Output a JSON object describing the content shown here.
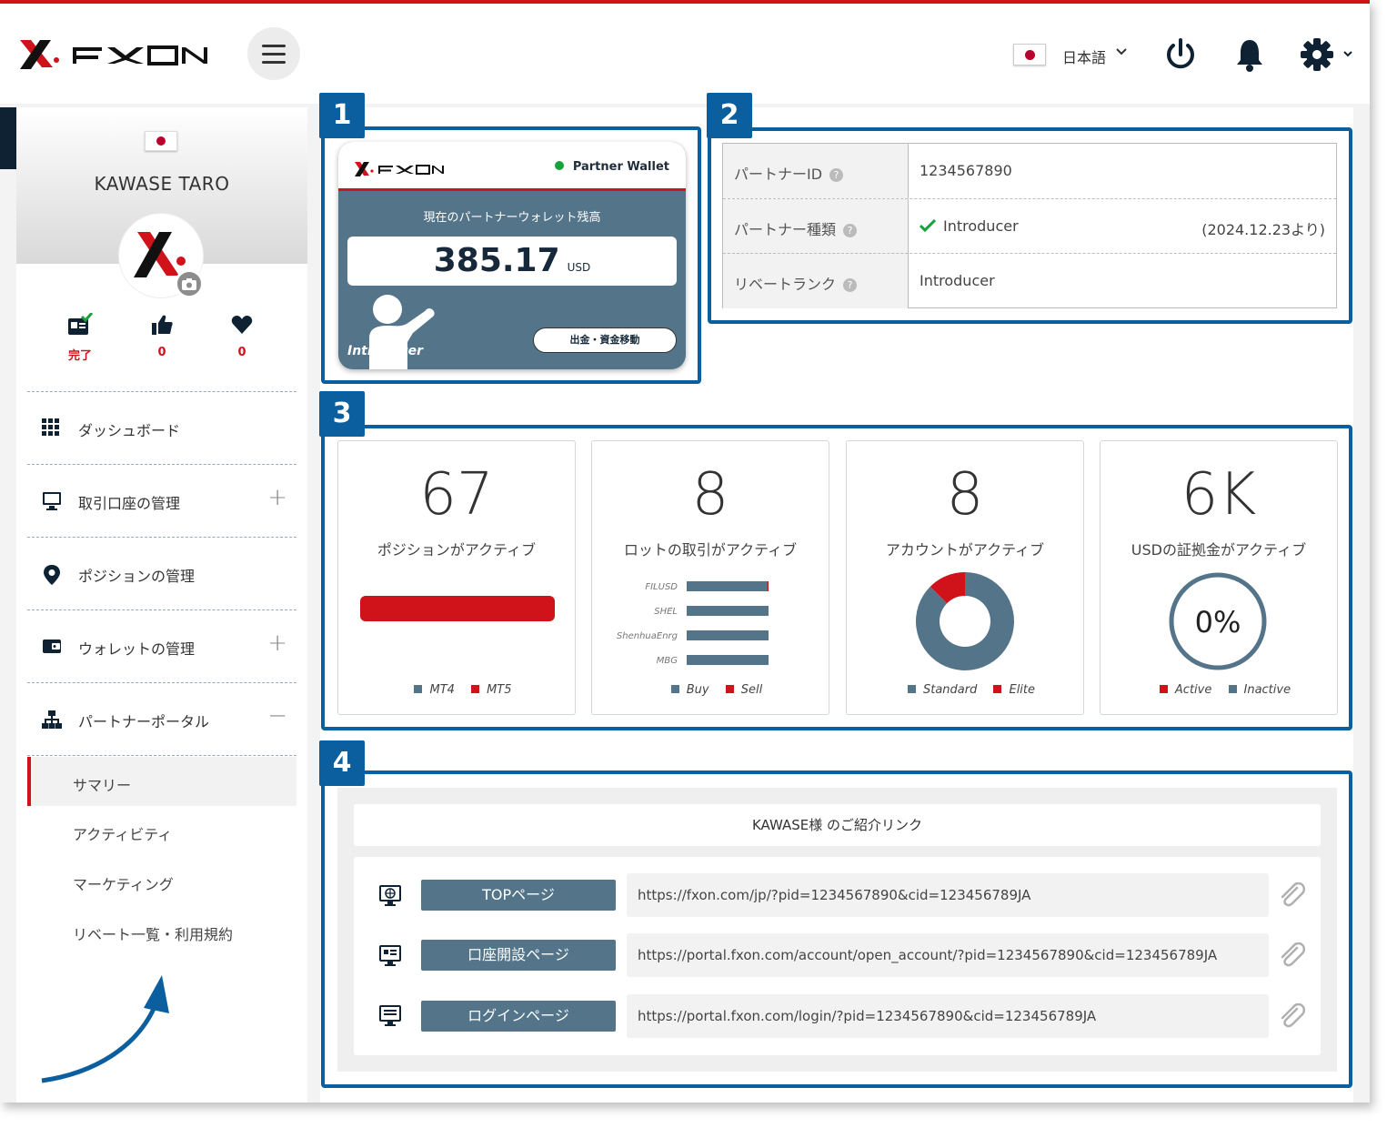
{
  "header": {
    "logo_text": "FXON",
    "language": "日本語",
    "menu_icon": "hamburger-icon",
    "icons": [
      "power-icon",
      "bell-icon",
      "gear-icon"
    ]
  },
  "profile": {
    "name": "KAWASE TARO",
    "stats": [
      {
        "icon": "id-card-check-icon",
        "value": "完了"
      },
      {
        "icon": "thumbs-up-icon",
        "value": "0"
      },
      {
        "icon": "heart-icon",
        "value": "0"
      }
    ]
  },
  "sidebar": {
    "items": [
      {
        "label": "ダッシュボード",
        "icon": "grid-icon",
        "toggle": ""
      },
      {
        "label": "取引口座の管理",
        "icon": "monitor-icon",
        "toggle": "+"
      },
      {
        "label": "ポジションの管理",
        "icon": "map-pin-icon",
        "toggle": ""
      },
      {
        "label": "ウォレットの管理",
        "icon": "wallet-icon",
        "toggle": "+"
      },
      {
        "label": "パートナーポータル",
        "icon": "org-chart-icon",
        "toggle": "−"
      }
    ],
    "subitems": [
      "サマリー",
      "アクティビティ",
      "マーケティング",
      "リベート一覧・利用規約"
    ]
  },
  "callouts": [
    "1",
    "2",
    "3",
    "4"
  ],
  "wallet": {
    "logo_text": "FXON",
    "title": "Partner Wallet",
    "subtitle": "現在のパートナーウォレット残高",
    "amount": "385.17",
    "currency": "USD",
    "button": "出金・資金移動",
    "badge": "Introducer"
  },
  "info": {
    "rows": [
      {
        "key": "パートナーID",
        "value": "1234567890",
        "date": ""
      },
      {
        "key": "パートナー種類",
        "value": "Introducer",
        "date": "(2024.12.23より)"
      },
      {
        "key": "リベートランク",
        "value": "Introducer",
        "date": ""
      }
    ],
    "help_icon": "?"
  },
  "stats": [
    {
      "value": "67",
      "caption": "ポジションがアクティブ",
      "legend": [
        "MT4",
        "MT5"
      ]
    },
    {
      "value": "8",
      "caption": "ロットの取引がアクティブ",
      "legend": [
        "Buy",
        "Sell"
      ]
    },
    {
      "value": "8",
      "caption": "アカウントがアクティブ",
      "legend": [
        "Standard",
        "Elite"
      ]
    },
    {
      "value": "6K",
      "caption": "USDの証拠金がアクティブ",
      "legend": [
        "Active",
        "Inactive"
      ],
      "gauge": "0%"
    }
  ],
  "colors": {
    "primary": "#537489",
    "accent": "#d0121b",
    "callout": "#0b5f9e"
  },
  "chart_data": [
    {
      "type": "bar",
      "categories": [
        "MT4",
        "MT5"
      ],
      "series": [
        {
          "name": "MT4",
          "values": [
            0
          ]
        },
        {
          "name": "MT5",
          "values": [
            67
          ]
        }
      ]
    },
    {
      "type": "bar",
      "categories": [
        "FILUSD",
        "SHEL",
        "ShenhuaEnrg",
        "MBG"
      ],
      "series": [
        {
          "name": "Buy",
          "values": [
            1.96,
            2,
            2,
            2
          ]
        },
        {
          "name": "Sell",
          "values": [
            0.04,
            0,
            0,
            0
          ]
        }
      ]
    },
    {
      "type": "pie",
      "categories": [
        "Standard",
        "Elite"
      ],
      "values": [
        7,
        1
      ]
    },
    {
      "type": "pie",
      "categories": [
        "Active",
        "Inactive"
      ],
      "values": [
        0,
        100
      ],
      "center_label": "0%"
    }
  ],
  "referral": {
    "title": "KAWASE様 のご紹介リンク",
    "links": [
      {
        "icon": "globe-monitor-icon",
        "label": "TOPページ",
        "url": "https://fxon.com/jp/?pid=1234567890&cid=123456789JA"
      },
      {
        "icon": "id-monitor-icon",
        "label": "口座開設ページ",
        "url": "https://portal.fxon.com/account/open_account/?pid=1234567890&cid=123456789JA"
      },
      {
        "icon": "list-monitor-icon",
        "label": "ログインページ",
        "url": "https://portal.fxon.com/login/?pid=1234567890&cid=123456789JA"
      }
    ]
  }
}
